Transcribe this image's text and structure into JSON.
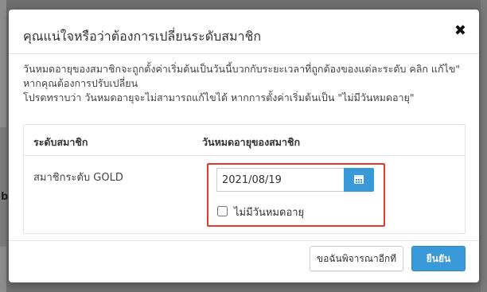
{
  "dialog": {
    "title": "คุณแน่ใจหรือว่าต้องการเปลี่ยนระดับสมาชิก",
    "close_glyph": "✖",
    "description": [
      "วันหมดอายุของสมาชิกจะถูกตั้งค่าเริ่มต้นเป็นวันนี้บวกกับระยะเวลาที่ถูกต้องของแต่ละระดับ คลิก แก้ไข\" หากคุณต้องการปรับเปลี่ยน",
      "โปรดทราบว่า วันหมดอายุจะไม่สามารถแก้ไขได้ หากการตั้งค่าเริ่มต้นเป็น \"ไม่มีวันหมดอายุ\""
    ],
    "table": {
      "headers": [
        "ระดับสมาชิก",
        "วันหมดอายุของสมาชิก"
      ],
      "row": {
        "level": "สมาชิกระดับ GOLD",
        "expiry_date": "2021/08/19",
        "no_expiry_label": "ไม่มีวันหมดอายุ",
        "no_expiry_checked": false
      }
    },
    "buttons": {
      "cancel": "ขอฉันพิจารณาอีกที",
      "confirm": "ยืนยัน"
    }
  },
  "background": {
    "partial_text": "b"
  },
  "icons": {
    "close": "close-icon",
    "calendar": "calendar-icon"
  },
  "colors": {
    "accent": "#3a99d8",
    "highlight": "#e53b2c",
    "overlay": "#6e6e6e"
  }
}
